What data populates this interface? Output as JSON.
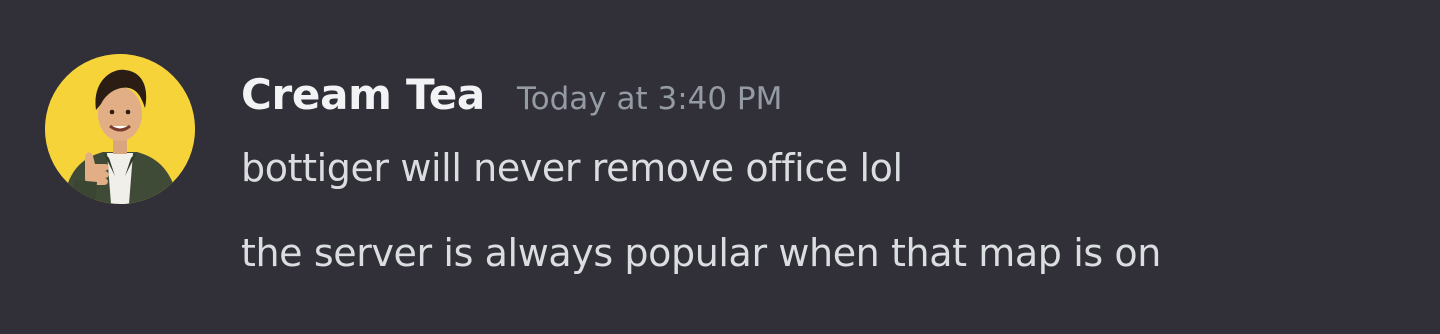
{
  "message": {
    "author": "Cream Tea",
    "timestamp": "Today at 3:40 PM",
    "avatar_icon": "user-avatar-photo",
    "avatar_background": "#f7d33a",
    "lines": [
      "bottiger will never remove office lol",
      "the server is always popular when that map is on"
    ]
  },
  "colors": {
    "background": "#313038",
    "username": "#f2f3f5",
    "timestamp": "#949ba4",
    "text": "#dbdee1"
  }
}
